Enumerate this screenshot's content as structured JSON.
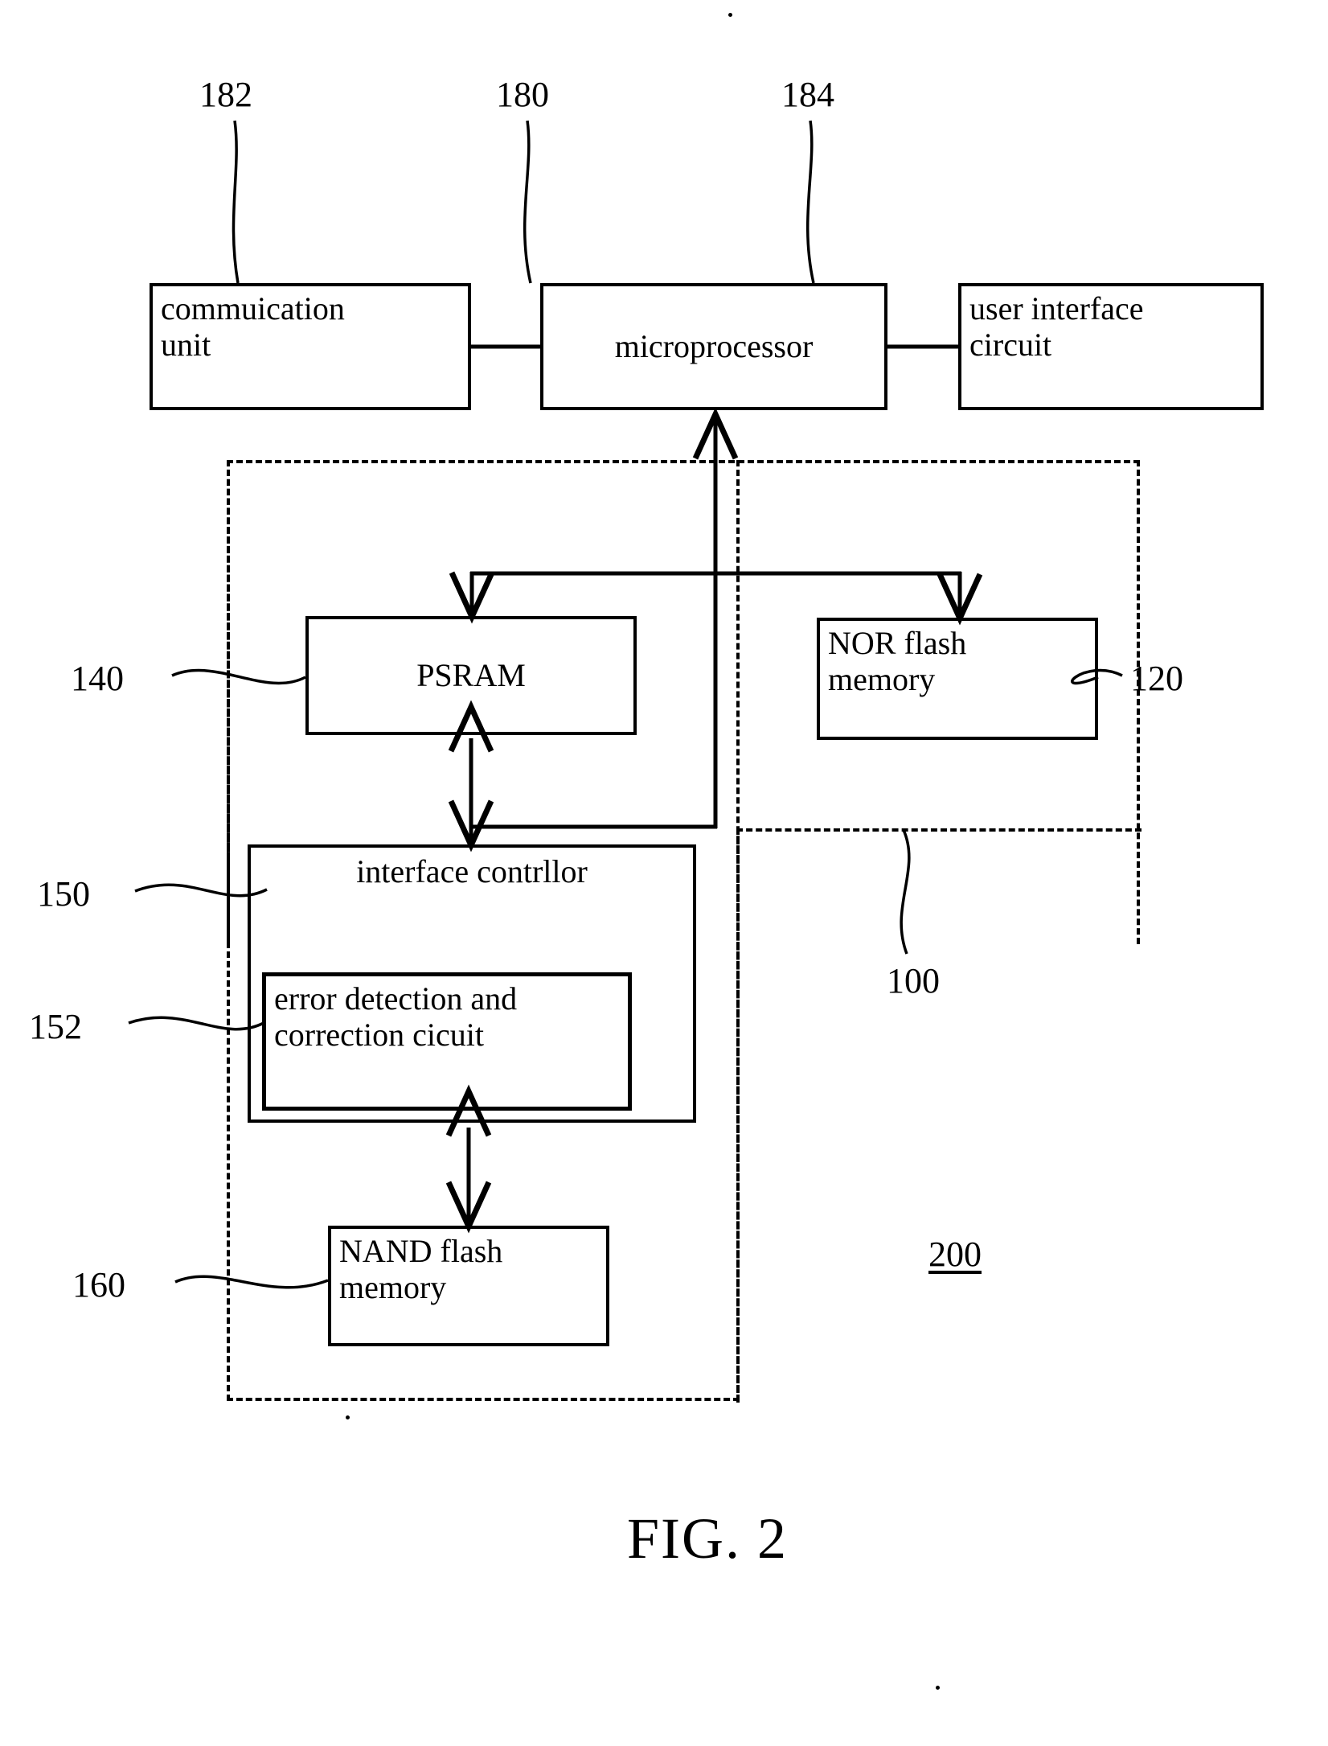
{
  "figure": {
    "caption": "FIG. 2",
    "system_ref": "200",
    "subsystem_ref": "100"
  },
  "blocks": [
    {
      "id": "communication_unit",
      "label_line1": "commuication",
      "label_line2": "unit",
      "ref": "182"
    },
    {
      "id": "microprocessor",
      "label_line1": "microprocessor",
      "label_line2": "",
      "ref": "180"
    },
    {
      "id": "user_interface_circuit",
      "label_line1": "user interface",
      "label_line2": "circuit",
      "ref": "184"
    },
    {
      "id": "psram",
      "label_line1": "PSRAM",
      "label_line2": "",
      "ref": "140"
    },
    {
      "id": "nor_flash_memory",
      "label_line1": "NOR flash",
      "label_line2": "memory",
      "ref": "120"
    },
    {
      "id": "interface_controller",
      "label_line1": "interface contrllor",
      "label_line2": "",
      "ref": "150"
    },
    {
      "id": "error_detection_correction_circuit",
      "label_line1": "error detection and",
      "label_line2": "correction cicuit",
      "ref": "152"
    },
    {
      "id": "nand_flash_memory",
      "label_line1": "NAND flash",
      "label_line2": "memory",
      "ref": "160"
    }
  ],
  "refs": {
    "r182": "182",
    "r180": "180",
    "r184": "184",
    "r140": "140",
    "r120": "120",
    "r150": "150",
    "r152": "152",
    "r160": "160",
    "r100": "100",
    "r200": "200"
  },
  "labels": {
    "communication_unit_l1": "commuication",
    "communication_unit_l2": "unit",
    "microprocessor": "microprocessor",
    "user_interface_l1": "user interface",
    "user_interface_l2": "circuit",
    "psram": "PSRAM",
    "nor_flash_l1": "NOR flash",
    "nor_flash_l2": "memory",
    "interface_controller": "interface contrllor",
    "edc_l1": "error detection and",
    "edc_l2": "correction cicuit",
    "nand_flash_l1": "NAND flash",
    "nand_flash_l2": "memory",
    "fig_caption": "FIG. 2"
  },
  "colors": {
    "line": "#000000",
    "background": "#ffffff"
  }
}
